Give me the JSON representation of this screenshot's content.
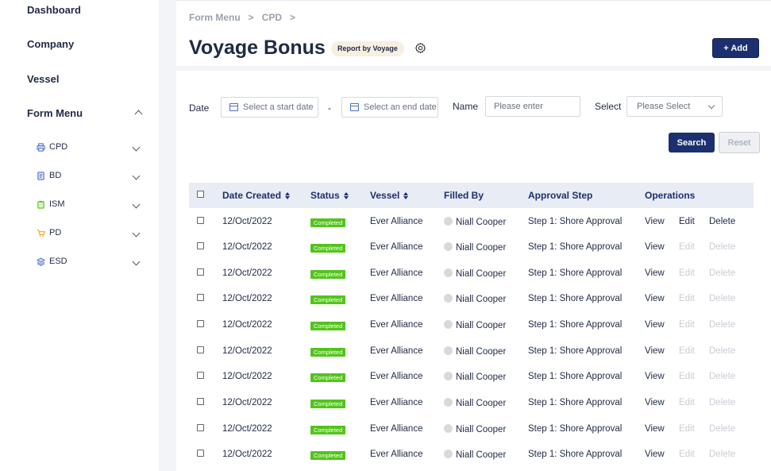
{
  "sidebar": {
    "items": [
      {
        "label": "Dashboard"
      },
      {
        "label": "Company"
      },
      {
        "label": "Vessel"
      },
      {
        "label": "Form Menu"
      }
    ],
    "sub_items": [
      {
        "label": "CPD",
        "icon": "printer-icon",
        "color": "#4a6fc9"
      },
      {
        "label": "BD",
        "icon": "document-icon",
        "color": "#4a6fc9"
      },
      {
        "label": "ISM",
        "icon": "clipboard-icon",
        "color": "#52c41a"
      },
      {
        "label": "PD",
        "icon": "cart-icon",
        "color": "#f5a623"
      },
      {
        "label": "ESD",
        "icon": "layers-icon",
        "color": "#4a6fc9"
      }
    ]
  },
  "header": {
    "breadcrumb": [
      "Form Menu",
      "CPD"
    ],
    "title": "Voyage Bonus",
    "tag": "Report by Voyage",
    "add_label": "+ Add"
  },
  "filters": {
    "date_label": "Date",
    "start_placeholder": "Select a start date",
    "separator": "-",
    "end_placeholder": "Select an end date",
    "name_label": "Name",
    "name_placeholder": "Please enter",
    "select_label": "Select",
    "select_value": "Please Select",
    "search_label": "Search",
    "reset_label": "Reset"
  },
  "table": {
    "columns": [
      "Date Created",
      "Status",
      "Vessel",
      "Filled By",
      "Approval Step",
      "Operations"
    ],
    "ops": {
      "view": "View",
      "edit": "Edit",
      "delete": "Delete"
    },
    "rows": [
      {
        "date": "12/Oct/2022",
        "status": "Completed",
        "vessel": "Ever Alliance",
        "filled_by": "Niall Cooper",
        "step": "Step 1: Shore Approval"
      },
      {
        "date": "12/Oct/2022",
        "status": "Completed",
        "vessel": "Ever Alliance",
        "filled_by": "Niall Cooper",
        "step": "Step 1: Shore Approval"
      },
      {
        "date": "12/Oct/2022",
        "status": "Completed",
        "vessel": "Ever Alliance",
        "filled_by": "Niall Cooper",
        "step": "Step 1: Shore Approval"
      },
      {
        "date": "12/Oct/2022",
        "status": "Completed",
        "vessel": "Ever Alliance",
        "filled_by": "Niall Cooper",
        "step": "Step 1: Shore Approval"
      },
      {
        "date": "12/Oct/2022",
        "status": "Completed",
        "vessel": "Ever Alliance",
        "filled_by": "Niall Cooper",
        "step": "Step 1: Shore Approval"
      },
      {
        "date": "12/Oct/2022",
        "status": "Completed",
        "vessel": "Ever Alliance",
        "filled_by": "Niall Cooper",
        "step": "Step 1: Shore Approval"
      },
      {
        "date": "12/Oct/2022",
        "status": "Completed",
        "vessel": "Ever Alliance",
        "filled_by": "Niall Cooper",
        "step": "Step 1: Shore Approval"
      },
      {
        "date": "12/Oct/2022",
        "status": "Completed",
        "vessel": "Ever Alliance",
        "filled_by": "Niall Cooper",
        "step": "Step 1: Shore Approval"
      },
      {
        "date": "12/Oct/2022",
        "status": "Completed",
        "vessel": "Ever Alliance",
        "filled_by": "Niall Cooper",
        "step": "Step 1: Shore Approval"
      },
      {
        "date": "12/Oct/2022",
        "status": "Completed",
        "vessel": "Ever Alliance",
        "filled_by": "Niall Cooper",
        "step": "Step 1: Shore Approval"
      }
    ]
  }
}
